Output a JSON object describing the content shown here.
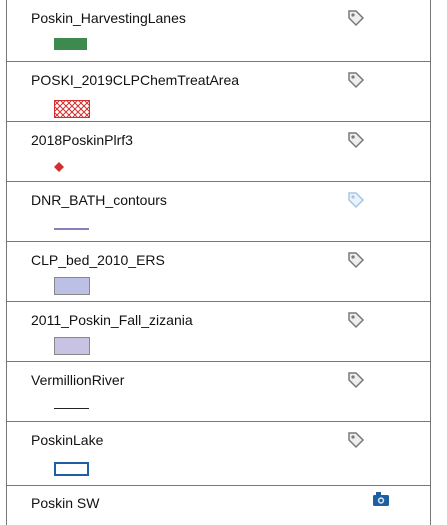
{
  "layers": [
    {
      "name": "Poskin_HarvestingLanes",
      "icon": "tag-icon",
      "symbol": "fill",
      "color": "#3e8a4e"
    },
    {
      "name": "POSKI_2019CLPChemTreatArea",
      "icon": "tag-icon",
      "symbol": "hatch",
      "color": "#d32f2f"
    },
    {
      "name": "2018PoskinPlrf3",
      "icon": "tag-icon",
      "symbol": "point",
      "color": "#d32f2f"
    },
    {
      "name": "DNR_BATH_contours",
      "icon": "tag-icon-light",
      "symbol": "line",
      "color": "#8a7fb8"
    },
    {
      "name": "CLP_bed_2010_ERS",
      "icon": "tag-icon",
      "symbol": "fill",
      "color": "#bcc0e6"
    },
    {
      "name": "2011_Poskin_Fall_zizania",
      "icon": "tag-icon",
      "symbol": "fill",
      "color": "#c8c3e2"
    },
    {
      "name": "VermillionRiver",
      "icon": "tag-icon",
      "symbol": "line",
      "color": "#222222"
    },
    {
      "name": "PoskinLake",
      "icon": "tag-icon",
      "symbol": "outline",
      "color": "#1f5fa0"
    },
    {
      "name": "Poskin SW",
      "icon": "camera-icon",
      "symbol": "none",
      "color": "#1f5fa0"
    }
  ]
}
